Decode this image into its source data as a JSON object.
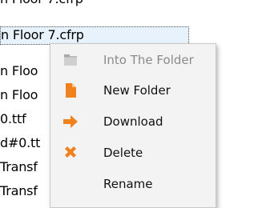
{
  "file_list": {
    "rows": [
      "n Floor 7.cfrp",
      "n Floor 7.cfrp",
      "n Floo",
      "n Floo",
      "0.ttf",
      "d#0.tt",
      "Transf",
      "Transf"
    ]
  },
  "context_menu": {
    "items": [
      {
        "label": "Into The Folder",
        "icon": "folder-icon",
        "enabled": false
      },
      {
        "label": "New Folder",
        "icon": "new-document-icon",
        "enabled": true
      },
      {
        "label": "Download",
        "icon": "download-arrow-icon",
        "enabled": true
      },
      {
        "label": "Delete",
        "icon": "delete-x-icon",
        "enabled": true
      },
      {
        "label": "Rename",
        "icon": "none",
        "enabled": true
      }
    ]
  },
  "colors": {
    "selection": "#e8f2fc",
    "menu_background": "#f3f3f3",
    "disabled_text": "#8a8a8a",
    "accent_orange": "#f0821e"
  }
}
